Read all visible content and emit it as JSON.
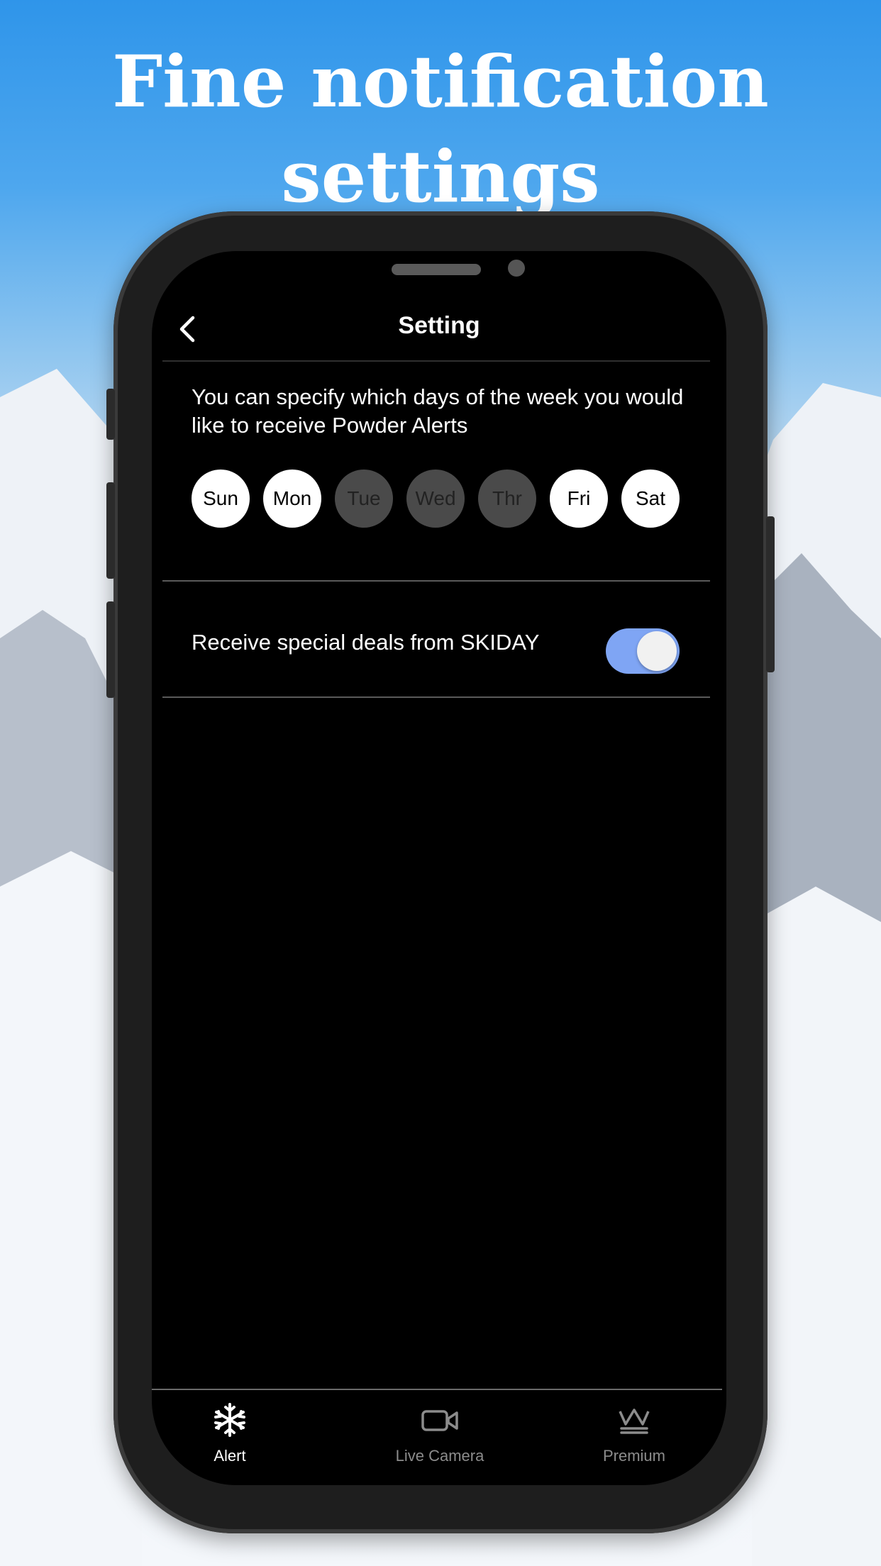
{
  "headline": {
    "line1": "Fine notification",
    "line2": "settings"
  },
  "nav": {
    "title": "Setting",
    "back_icon": "chevron-left-icon"
  },
  "powder_alerts": {
    "description": "You can specify which days of the week you would like to receive Powder Alerts",
    "days": [
      {
        "label": "Sun",
        "selected": true
      },
      {
        "label": "Mon",
        "selected": true
      },
      {
        "label": "Tue",
        "selected": false
      },
      {
        "label": "Wed",
        "selected": false
      },
      {
        "label": "Thr",
        "selected": false
      },
      {
        "label": "Fri",
        "selected": true
      },
      {
        "label": "Sat",
        "selected": true
      }
    ]
  },
  "special_deals": {
    "label": "Receive special deals from SKIDAY",
    "enabled": true,
    "toggle_color": "#7fa5f4"
  },
  "tabbar": {
    "tabs": [
      {
        "label": "Alert",
        "icon": "snowflake-icon",
        "active": true
      },
      {
        "label": "Live Camera",
        "icon": "video-camera-icon",
        "active": false
      },
      {
        "label": "Premium",
        "icon": "crown-icon",
        "active": false
      }
    ]
  }
}
